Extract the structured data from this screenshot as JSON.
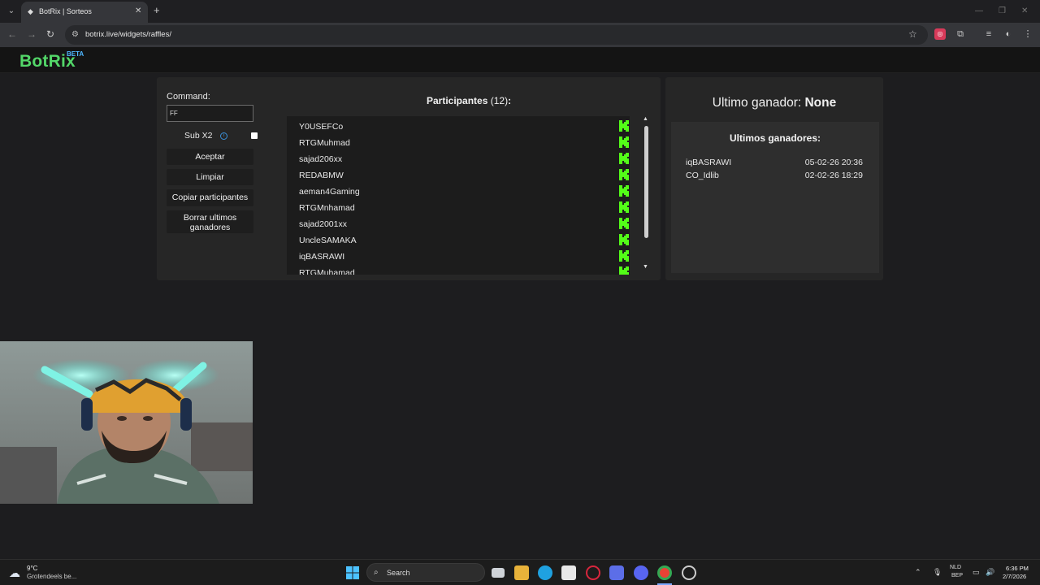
{
  "browser": {
    "tab_title": "BotRix | Sorteos",
    "url": "botrix.live/widgets/raffles/"
  },
  "header": {
    "logo": "BotRix",
    "badge": "BETA"
  },
  "controls": {
    "command_label": "Command:",
    "command_value": "FF",
    "sub_label": "Sub X2",
    "sub_checked": false,
    "accept_label": "Aceptar",
    "clear_label": "Limpiar",
    "copy_label": "Copiar participantes",
    "delete_label": "Borrar ultimos ganadores"
  },
  "participants": {
    "title": "Participantes",
    "count": "(12)",
    "colon": ":",
    "items": [
      "Y0USEFCo",
      "RTGMuhmad",
      "sajad206xx",
      "REDABMW",
      "aeman4Gaming",
      "RTGMnhamad",
      "sajad2001xx",
      "UncleSAMAKA",
      "iqBASRAWI",
      "RTGMuhamad"
    ]
  },
  "winners": {
    "last_label": "Ultimo ganador:",
    "last_value": "None",
    "list_title": "Ultimos ganadores:",
    "items": [
      {
        "name": "iqBASRAWI",
        "date": "05-02-26 20:36"
      },
      {
        "name": "CO_Idlib",
        "date": "02-02-26 18:29"
      }
    ]
  },
  "taskbar": {
    "weather_temp": "9°C",
    "weather_desc": "Grotendeels be...",
    "search_label": "Search",
    "lang1": "NLD",
    "lang2": "BEP",
    "time": "6:36 PM",
    "date": "2/7/2026"
  },
  "colors": {
    "brand_green": "#53d769",
    "kick_green": "#53fc18",
    "beta_blue": "#4fb7ff"
  }
}
